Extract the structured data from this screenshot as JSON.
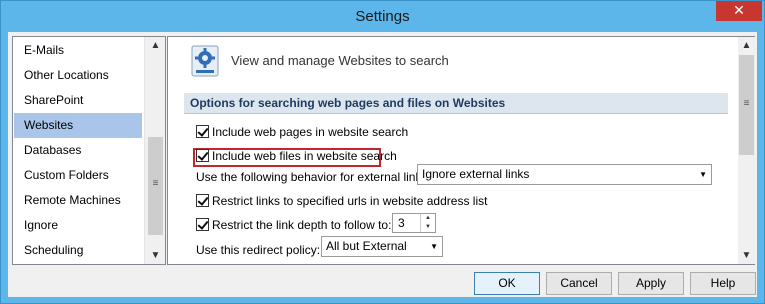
{
  "window": {
    "title": "Settings",
    "close_glyph": "✕"
  },
  "nav": {
    "items": [
      {
        "label": "E-Mails",
        "selected": false
      },
      {
        "label": "Other Locations",
        "selected": false
      },
      {
        "label": "SharePoint",
        "selected": false
      },
      {
        "label": "Websites",
        "selected": true
      },
      {
        "label": "Databases",
        "selected": false
      },
      {
        "label": "Custom Folders",
        "selected": false
      },
      {
        "label": "Remote Machines",
        "selected": false
      },
      {
        "label": "Ignore",
        "selected": false
      },
      {
        "label": "Scheduling",
        "selected": false
      }
    ]
  },
  "panel": {
    "header_text": "View and manage Websites to search",
    "header_icon": "gear-icon",
    "section_title": "Options for searching web pages and files on Websites",
    "include_pages_label": "Include web pages in website search",
    "include_pages_checked": true,
    "include_files_label": "Include web files in website search",
    "include_files_checked": true,
    "external_links_label": "Use the following behavior for external links:",
    "external_links_value": "Ignore external links",
    "restrict_urls_label": "Restrict links to specified urls in website address list",
    "restrict_urls_checked": true,
    "restrict_depth_label": "Restrict the link depth to follow to:",
    "restrict_depth_checked": true,
    "depth_value": "3",
    "redirect_label": "Use this redirect policy:",
    "redirect_value": "All but External"
  },
  "buttons": {
    "ok": "OK",
    "cancel": "Cancel",
    "apply": "Apply",
    "help": "Help"
  },
  "colors": {
    "title_bar": "#5cb6ea",
    "close": "#c7372f",
    "selected": "#a9c5ea",
    "highlight": "#c0282b"
  }
}
